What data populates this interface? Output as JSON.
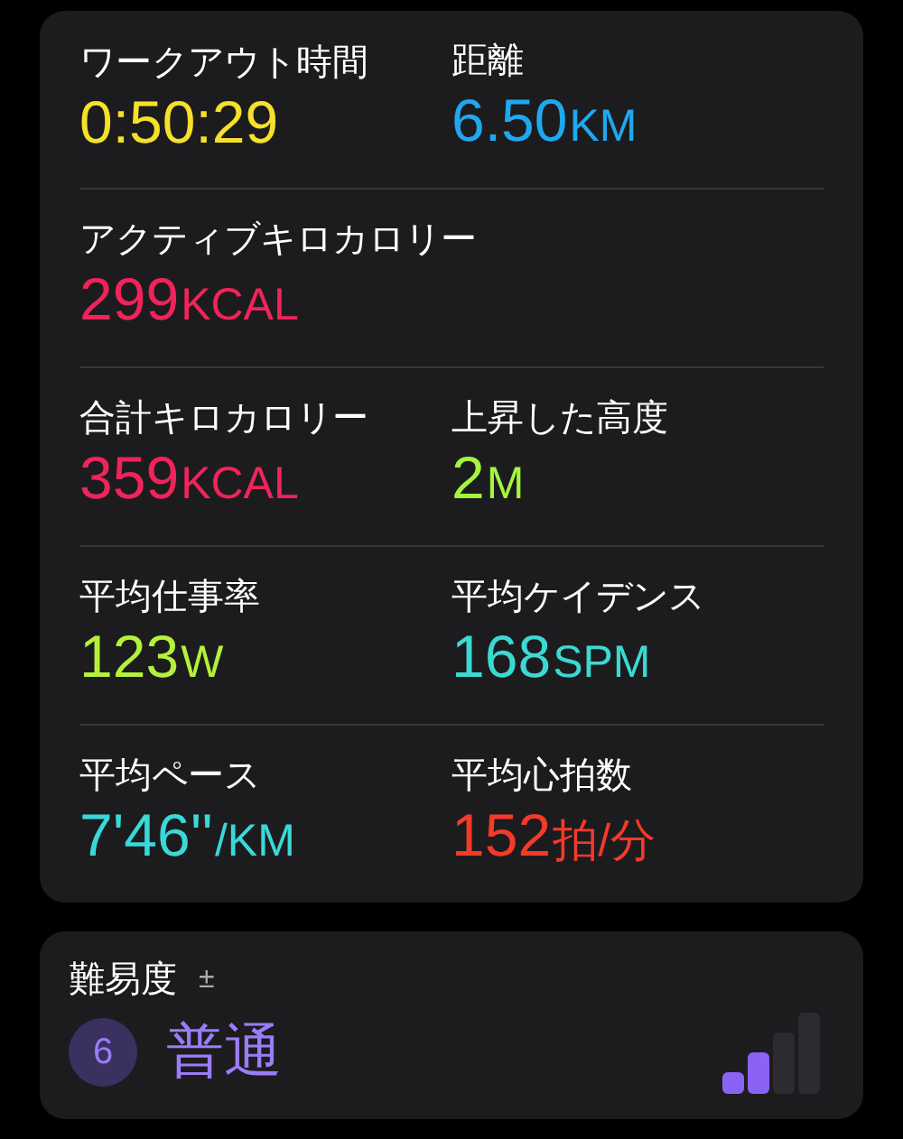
{
  "metrics_rows": [
    {
      "metrics": [
        {
          "label": "ワークアウト時間",
          "value": "0:50:29",
          "color": "#f5e02b"
        },
        {
          "label": "距離",
          "value": "6.50",
          "unit": "KM",
          "color": "#1fa8ee"
        }
      ]
    },
    {
      "metrics": [
        {
          "label": "アクティブキロカロリー",
          "value": "299",
          "unit": "KCAL",
          "color": "#f0245a"
        }
      ]
    },
    {
      "metrics": [
        {
          "label": "合計キロカロリー",
          "value": "359",
          "unit": "KCAL",
          "color": "#f0245a"
        },
        {
          "label": "上昇した高度",
          "value": "2",
          "unit": "M",
          "color": "#a4f53c"
        }
      ]
    },
    {
      "metrics": [
        {
          "label": "平均仕事率",
          "value": "123",
          "unit": "W",
          "color": "#b5f03a"
        },
        {
          "label": "平均ケイデンス",
          "value": "168",
          "unit": "SPM",
          "color": "#3cd9d3"
        }
      ]
    },
    {
      "metrics": [
        {
          "label": "平均ペース",
          "value": "7'46''",
          "unit": "/KM",
          "color": "#3ad8d8"
        },
        {
          "label": "平均心拍数",
          "value": "152",
          "unit": "拍/分",
          "color": "#f53a2a"
        }
      ]
    }
  ],
  "difficulty": {
    "label": "難易度",
    "adjust": "±",
    "score": "6",
    "rating": "普通",
    "level": 0.5
  }
}
